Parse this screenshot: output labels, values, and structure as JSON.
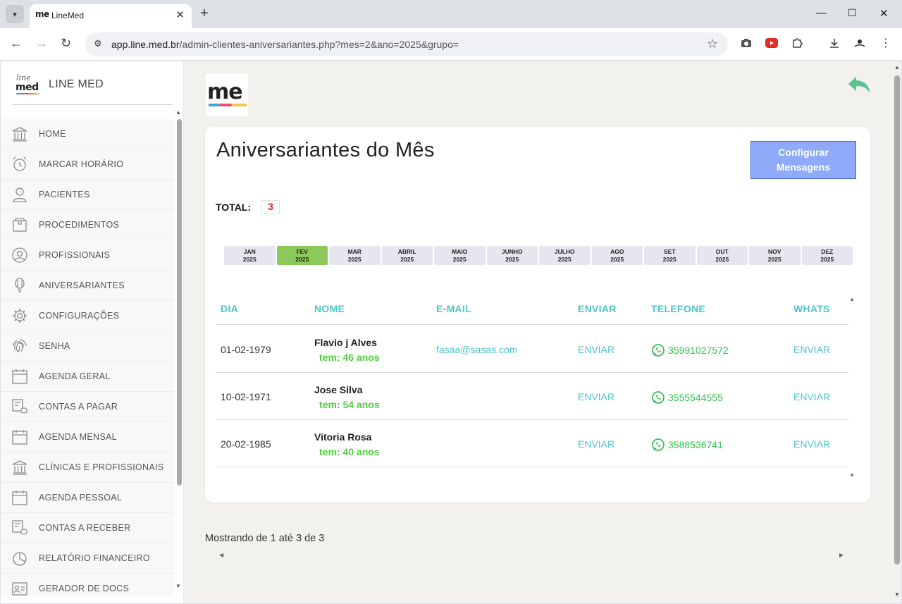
{
  "browser": {
    "tab_title": "LineMed",
    "tab_favicon_text": "me",
    "url_host": "app.line.med.br",
    "url_path": "/admin-clientes-aniversariantes.php?mes=2&ano=2025&grupo="
  },
  "sidebar": {
    "logo_top": "line",
    "logo_bottom": "med",
    "brand_name": "LINE MED",
    "items": [
      {
        "label": "HOME",
        "icon": "bank-icon"
      },
      {
        "label": "MARCAR HORÁRIO",
        "icon": "alarm-clock-icon"
      },
      {
        "label": "PACIENTES",
        "icon": "user-icon"
      },
      {
        "label": "PROCEDIMENTOS",
        "icon": "box-icon"
      },
      {
        "label": "PROFISSIONAIS",
        "icon": "user-circle-icon"
      },
      {
        "label": "ANIVERSARIANTES",
        "icon": "balloon-icon"
      },
      {
        "label": "CONFIGURAÇÕES",
        "icon": "gear-icon"
      },
      {
        "label": "SENHA",
        "icon": "fingerprint-icon"
      },
      {
        "label": "AGENDA GERAL",
        "icon": "calendar-icon"
      },
      {
        "label": "CONTAS A PAGAR",
        "icon": "coins-icon"
      },
      {
        "label": "AGENDA MENSAL",
        "icon": "calendar-icon"
      },
      {
        "label": "CLÍNICAS E PROFISSIONAIS",
        "icon": "bank-icon"
      },
      {
        "label": "AGENDA PESSOAL",
        "icon": "calendar-icon"
      },
      {
        "label": "CONTAS A RECEBER",
        "icon": "coins-icon"
      },
      {
        "label": "RELATÓRIO FINANCEIRO",
        "icon": "pie-chart-icon"
      },
      {
        "label": "GERADOR DE DOCS",
        "icon": "id-card-icon"
      }
    ]
  },
  "main": {
    "logo_text": "me",
    "title": "Aniversariantes do Mês",
    "config_button": "Configurar Mensagens",
    "total_label": "TOTAL:",
    "total_value": "3",
    "months": [
      {
        "name": "JAN",
        "year": "2025",
        "active": false
      },
      {
        "name": "FEV",
        "year": "2025",
        "active": true
      },
      {
        "name": "MAR",
        "year": "2025",
        "active": false
      },
      {
        "name": "ABRIL",
        "year": "2025",
        "active": false
      },
      {
        "name": "MAIO",
        "year": "2025",
        "active": false
      },
      {
        "name": "JUNHO",
        "year": "2025",
        "active": false
      },
      {
        "name": "JULHO",
        "year": "2025",
        "active": false
      },
      {
        "name": "AGO",
        "year": "2025",
        "active": false
      },
      {
        "name": "SET",
        "year": "2025",
        "active": false
      },
      {
        "name": "OUT",
        "year": "2025",
        "active": false
      },
      {
        "name": "NOV",
        "year": "2025",
        "active": false
      },
      {
        "name": "DEZ",
        "year": "2025",
        "active": false
      }
    ],
    "table": {
      "headers": {
        "dia": "DIA",
        "nome": "NOME",
        "email": "E-MAIL",
        "enviar": "ENVIAR",
        "telefone": "TELEFONE",
        "whats": "WHATS"
      },
      "rows": [
        {
          "dia": "01-02-1979",
          "nome": "Flavio j Alves",
          "idade": "tem: 46 anos",
          "email": "fasaa@sasas.com",
          "enviar": "ENVIAR",
          "telefone": "35991027572",
          "whats": "ENVIAR"
        },
        {
          "dia": "10-02-1971",
          "nome": "Jose Silva",
          "idade": "tem: 54 anos",
          "email": "",
          "enviar": "ENVIAR",
          "telefone": "3555544555",
          "whats": "ENVIAR"
        },
        {
          "dia": "20-02-1985",
          "nome": "Vitoria Rosa",
          "idade": "tem: 40 anos",
          "email": "",
          "enviar": "ENVIAR",
          "telefone": "3588536741",
          "whats": "ENVIAR"
        }
      ]
    },
    "footer": "Mostrando de 1 até 3 de 3"
  },
  "colors": {
    "accent_teal": "#4ec3cc",
    "whatsapp_green": "#34c14d",
    "age_green": "#4ccf3a",
    "active_month": "#8cc95a",
    "config_button": "#8eaaf8",
    "back_arrow": "#5cc28e"
  }
}
